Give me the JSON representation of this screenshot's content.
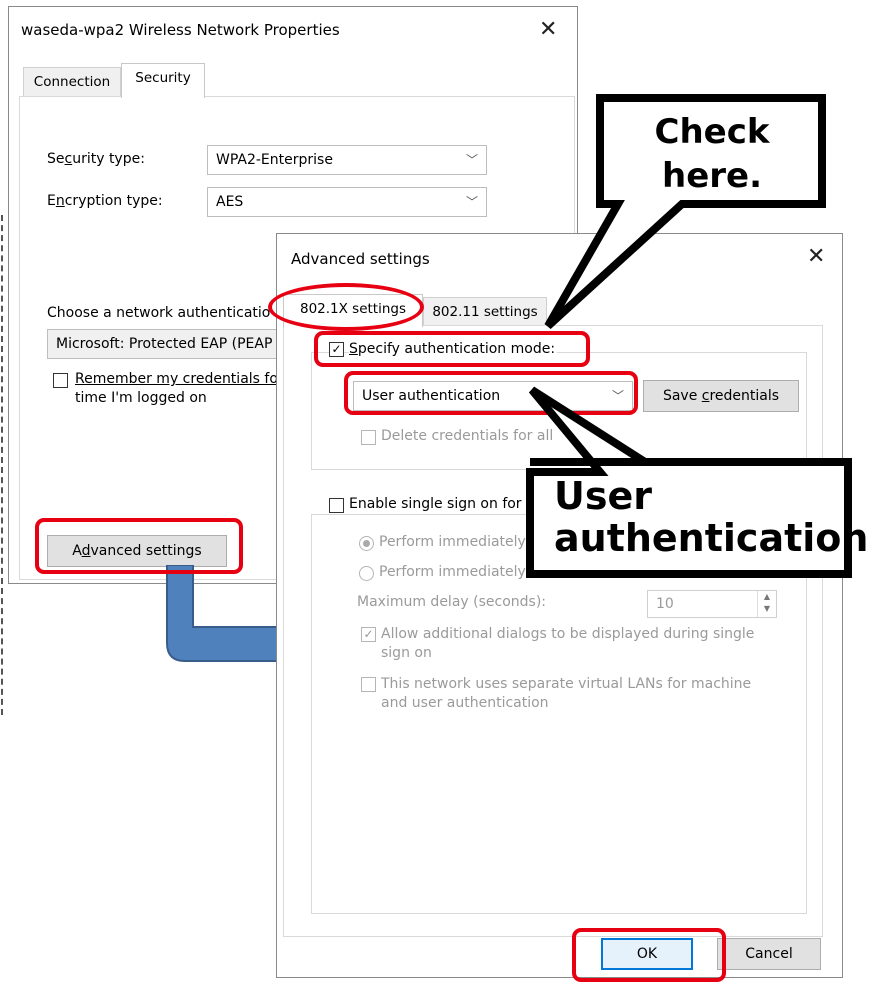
{
  "background_window": {
    "title": "waseda-wpa2 Wireless Network Properties",
    "tabs": [
      "Connection",
      "Security"
    ],
    "security_type_label": "Security type:",
    "security_type_value": "WPA2-Enterprise",
    "encryption_type_label": "Encryption type:",
    "encryption_type_value": "AES",
    "auth_method_label": "Choose a network authenticatio",
    "auth_method_value": "Microsoft: Protected EAP (PEAP",
    "remember_label_line1": "Remember my credentials fo",
    "remember_label_line2": "time I'm logged on",
    "advanced_button": "Advanced settings"
  },
  "advanced_dialog": {
    "title": "Advanced settings",
    "tabs": [
      "802.1X settings",
      "802.11 settings"
    ],
    "specify_auth_label": "Specify authentication mode:",
    "specify_auth_checked": true,
    "auth_mode_value": "User authentication",
    "save_credentials_button": "Save credentials",
    "delete_credentials_label": "Delete credentials for all",
    "sso_label": "Enable single sign on for",
    "perform_before": "Perform immediately",
    "perform_after": "Perform immediately",
    "max_delay_label": "Maximum delay (seconds):",
    "max_delay_value": "10",
    "allow_dialogs_label": "Allow additional dialogs to be displayed during single sign on",
    "separate_vlans_label": "This network uses separate virtual LANs for machine and user authentication",
    "ok_button": "OK",
    "cancel_button": "Cancel"
  },
  "callouts": {
    "check_here": "Check here.",
    "user_auth_line1": "User",
    "user_auth_line2": "authentication"
  },
  "colors": {
    "highlight_red": "#e60012",
    "arrow_blue": "#4f81bd",
    "ok_border_blue": "#0078d7"
  }
}
